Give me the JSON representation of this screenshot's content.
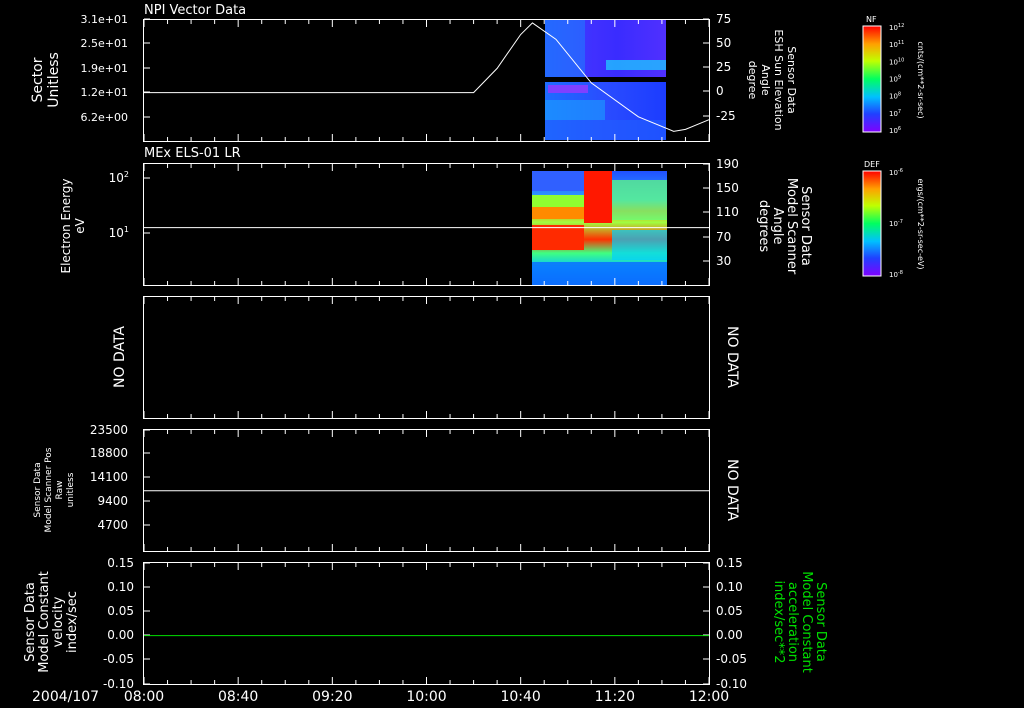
{
  "date_label": "2004/107",
  "time_ticks": [
    "08:00",
    "08:40",
    "09:20",
    "10:00",
    "10:40",
    "11:20",
    "12:00"
  ],
  "colors": {
    "background": "#000000",
    "axis": "#ffffff",
    "green": "#00e000"
  },
  "panels": [
    {
      "title": "NPI Vector Data",
      "left_labels": [
        "Sector",
        "Unitless"
      ],
      "left_ticks": [
        "3.1e+01",
        "2.5e+01",
        "1.9e+01",
        "1.2e+01",
        "6.2e+00"
      ],
      "right_labels": [
        "Sensor Data",
        "ESH Sun Elevation",
        "Angle",
        "degree"
      ],
      "right_ticks": [
        "75",
        "50",
        "25",
        "0",
        "-25"
      ],
      "colorbar": {
        "label": "NF",
        "unit": "cnts/(cm**2-sr-sec)",
        "ticks": [
          "10^12",
          "10^11",
          "10^10",
          "10^9",
          "10^8",
          "10^7",
          "10^6"
        ]
      }
    },
    {
      "title": "MEx ELS-01 LR",
      "left_labels": [
        "Electron Energy",
        "eV"
      ],
      "left_ticks": [
        "10^2",
        "10^1"
      ],
      "right_labels": [
        "Sensor Data",
        "Model Scanner",
        "Angle",
        "degrees"
      ],
      "right_ticks": [
        "190",
        "150",
        "110",
        "70",
        "30"
      ],
      "colorbar": {
        "label": "DEF",
        "unit": "ergs/(cm**2-sr-sec-eV)",
        "ticks": [
          "10^-6",
          "10^-7",
          "10^-8"
        ]
      }
    },
    {
      "left_labels": [
        "NO DATA"
      ],
      "right_labels": [
        "NO DATA"
      ]
    },
    {
      "left_labels": [
        "Sensor Data",
        "Model Scanner Pos",
        "Raw",
        "unitless"
      ],
      "left_ticks": [
        "23500",
        "18800",
        "14100",
        "9400",
        "4700"
      ],
      "right_labels": [
        "NO DATA"
      ]
    },
    {
      "left_labels": [
        "Sensor Data",
        "Model Constant",
        "velocity",
        "index/sec"
      ],
      "left_ticks": [
        "0.15",
        "0.10",
        "0.05",
        "0.00",
        "-0.05",
        "-0.10"
      ],
      "right_labels": [
        "Sensor Data",
        "Model Constant",
        "acceleration",
        "index/sec**2"
      ],
      "right_ticks": [
        "0.15",
        "0.10",
        "0.05",
        "0.00",
        "-0.05",
        "-0.10"
      ]
    }
  ],
  "chart_data": [
    {
      "type": "line",
      "title": "NPI Vector Data",
      "x_unit": "time (2004/107)",
      "xlim": [
        "08:00",
        "12:00"
      ],
      "ylabel": "Sector Unitless",
      "ylabel_right": "Sensor Data ESH Sun Elevation Angle degree",
      "ylim_right": [
        -50,
        75
      ],
      "series": [
        {
          "x": [
            "08:00",
            "09:00",
            "10:00",
            "10:20",
            "10:30",
            "10:40",
            "10:45",
            "10:55",
            "11:10",
            "11:30",
            "11:45",
            "11:50",
            "12:00"
          ],
          "values": [
            0,
            0,
            0,
            0,
            25,
            60,
            72,
            55,
            10,
            -25,
            -40,
            -38,
            -28
          ]
        }
      ],
      "spectrogram_time_range": [
        "10:45",
        "11:47"
      ],
      "spectrogram_gap": true
    },
    {
      "type": "heatmap",
      "title": "MEx ELS-01 LR",
      "ylabel": "Electron Energy eV",
      "y_scale": "log",
      "spectrogram_time_range": [
        "10:32",
        "11:47"
      ],
      "ylabel_right": "Sensor Data Model Scanner Angle degrees",
      "ylim_right": [
        0,
        190
      ],
      "series": [
        {
          "x": [
            "08:00",
            "12:00"
          ],
          "values": [
            90,
            90
          ]
        }
      ]
    },
    {
      "type": "line",
      "no_data": true
    },
    {
      "type": "line",
      "ylabel": "Sensor Data Model Scanner Pos Raw unitless",
      "ylim": [
        0,
        23500
      ],
      "series": [
        {
          "x": [
            "08:00",
            "12:00"
          ],
          "values": [
            11700,
            11700
          ]
        }
      ]
    },
    {
      "type": "line",
      "ylim": [
        -0.1,
        0.15
      ],
      "ylabel": "Sensor Data Model Constant velocity index/sec",
      "ylabel_right": "Sensor Data Model Constant acceleration index/sec**2",
      "series": [
        {
          "x": [
            "08:00",
            "12:00"
          ],
          "values": [
            0.0,
            0.0
          ]
        }
      ]
    }
  ]
}
